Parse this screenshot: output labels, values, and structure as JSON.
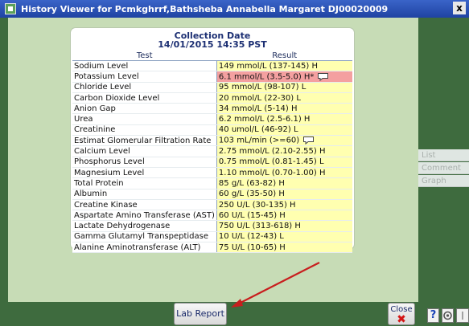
{
  "window": {
    "title": "History Viewer for Pcmkghrrf,Bathsheba Annabella Margaret  DJ00020009",
    "close_label": "x"
  },
  "collection": {
    "heading": "Collection Date",
    "datetime": "14/01/2015 14:35 PST"
  },
  "table": {
    "headers": [
      "Test",
      "Result"
    ],
    "rows": [
      {
        "test": "Sodium Level",
        "result": "149 mmol/L (137-145)  H",
        "critical": false
      },
      {
        "test": "Potassium Level",
        "result": "6.1 mmol/L (3.5-5.0)  H*",
        "critical": true,
        "note": true
      },
      {
        "test": "Chloride Level",
        "result": "95 mmol/L (98-107)  L",
        "critical": false
      },
      {
        "test": "Carbon Dioxide Level",
        "result": "20 mmol/L (22-30)  L",
        "critical": false
      },
      {
        "test": "Anion Gap",
        "result": "34 mmol/L (5-14)  H",
        "critical": false
      },
      {
        "test": "Urea",
        "result": "6.2 mmol/L (2.5-6.1)  H",
        "critical": false
      },
      {
        "test": "Creatinine",
        "result": "40 umol/L (46-92)  L",
        "critical": false
      },
      {
        "test": "Estimat Glomerular Filtration Rate",
        "result": "103 mL/min  (>=60)",
        "critical": false,
        "note": true
      },
      {
        "test": "Calcium Level",
        "result": "2.75 mmol/L (2.10-2.55)  H",
        "critical": false
      },
      {
        "test": "Phosphorus Level",
        "result": "0.75 mmol/L (0.81-1.45)  L",
        "critical": false
      },
      {
        "test": "Magnesium Level",
        "result": "1.10 mmol/L (0.70-1.00)  H",
        "critical": false
      },
      {
        "test": "Total Protein",
        "result": "85 g/L  (63-82)  H",
        "critical": false
      },
      {
        "test": "Albumin",
        "result": "60 g/L  (35-50)  H",
        "critical": false
      },
      {
        "test": "Creatine Kinase",
        "result": "250 U/L  (30-135)  H",
        "critical": false
      },
      {
        "test": "Aspartate Amino Transferase (AST)",
        "result": "60 U/L  (15-45)  H",
        "critical": false
      },
      {
        "test": "Lactate Dehydrogenase",
        "result": "750 U/L  (313-618)  H",
        "critical": false
      },
      {
        "test": "Gamma Glutamyl Transpeptidase",
        "result": "10 U/L  (12-43)  L",
        "critical": false
      },
      {
        "test": "Alanine Aminotransferase (ALT)",
        "result": "75 U/L  (10-65)  H",
        "critical": false
      }
    ]
  },
  "side_buttons": {
    "list": "List",
    "comment": "Comment",
    "graph": "Graph"
  },
  "footer": {
    "lab_report_label": "Lab Report",
    "close_label": "Close",
    "help_label": "?"
  },
  "colors": {
    "panel_green": "#c7dcb6",
    "frame_green": "#3e6b3e",
    "result_yellow": "#ffffb0",
    "critical_red": "#f4a0a0",
    "annotation_arrow": "#c81e1e"
  },
  "icons": {
    "note": "speech-bubble-icon",
    "close": "red-x-icon"
  }
}
